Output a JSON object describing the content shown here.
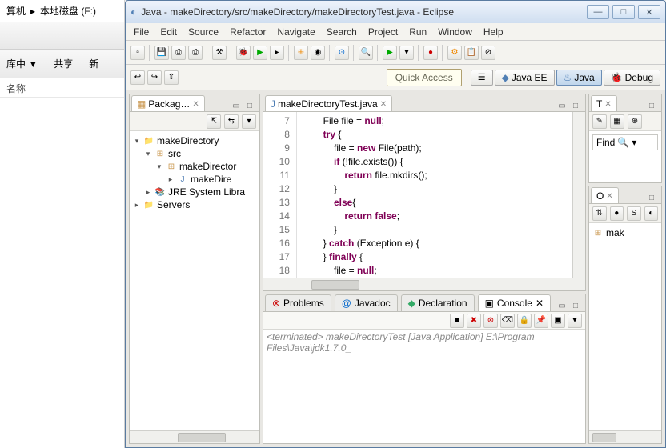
{
  "explorer": {
    "back_label": "算机",
    "crumb": "本地磁盘 (F:)",
    "cmd_lib": "库中 ▼",
    "cmd_share": "共享",
    "cmd_new": "新",
    "col_name": "名称"
  },
  "eclipse": {
    "title": "Java - makeDirectory/src/makeDirectory/makeDirectoryTest.java - Eclipse",
    "menu": [
      "File",
      "Edit",
      "Source",
      "Refactor",
      "Navigate",
      "Search",
      "Project",
      "Run",
      "Window",
      "Help"
    ],
    "quick_access": "Quick Access",
    "perspectives": {
      "java_ee": "Java EE",
      "java": "Java",
      "debug": "Debug"
    }
  },
  "package_explorer": {
    "title": "Packag…",
    "tree": {
      "proj": "makeDirectory",
      "src": "src",
      "pkg": "makeDirector",
      "file": "makeDire",
      "jre": "JRE System Libra",
      "servers": "Servers"
    }
  },
  "editor": {
    "tab": "makeDirectoryTest.java",
    "lines": [
      "7",
      "8",
      "9",
      "10",
      "11",
      "12",
      "13",
      "14",
      "15",
      "16",
      "17",
      "18"
    ],
    "code": {
      "l7_a": "File file = ",
      "l7_b": "null",
      "l7_c": ";",
      "l8_a": "try",
      "l8_b": " {",
      "l9_a": "    file = ",
      "l9_b": "new",
      "l9_c": " File(path);",
      "l10_a": "    ",
      "l10_b": "if",
      "l10_c": " (!file.exists()) {",
      "l11_a": "        ",
      "l11_b": "return",
      "l11_c": " file.mkdirs();",
      "l12": "    }",
      "l13_a": "    ",
      "l13_b": "else",
      "l13_c": "{",
      "l14_a": "        ",
      "l14_b": "return false",
      "l14_c": ";",
      "l15": "    }",
      "l16_a": "} ",
      "l16_b": "catch",
      "l16_c": " (Exception e) {",
      "l17_a": "} ",
      "l17_b": "finally",
      "l17_c": " {",
      "l18_a": "    file = ",
      "l18_b": "null",
      "l18_c": ";"
    }
  },
  "right": {
    "task_title": "T",
    "outline_title": "O",
    "find": "Find",
    "mak": "mak"
  },
  "console": {
    "tabs": {
      "problems": "Problems",
      "javadoc": "Javadoc",
      "declaration": "Declaration",
      "console": "Console"
    },
    "status": "<terminated> makeDirectoryTest [Java Application] E:\\Program Files\\Java\\jdk1.7.0_"
  }
}
